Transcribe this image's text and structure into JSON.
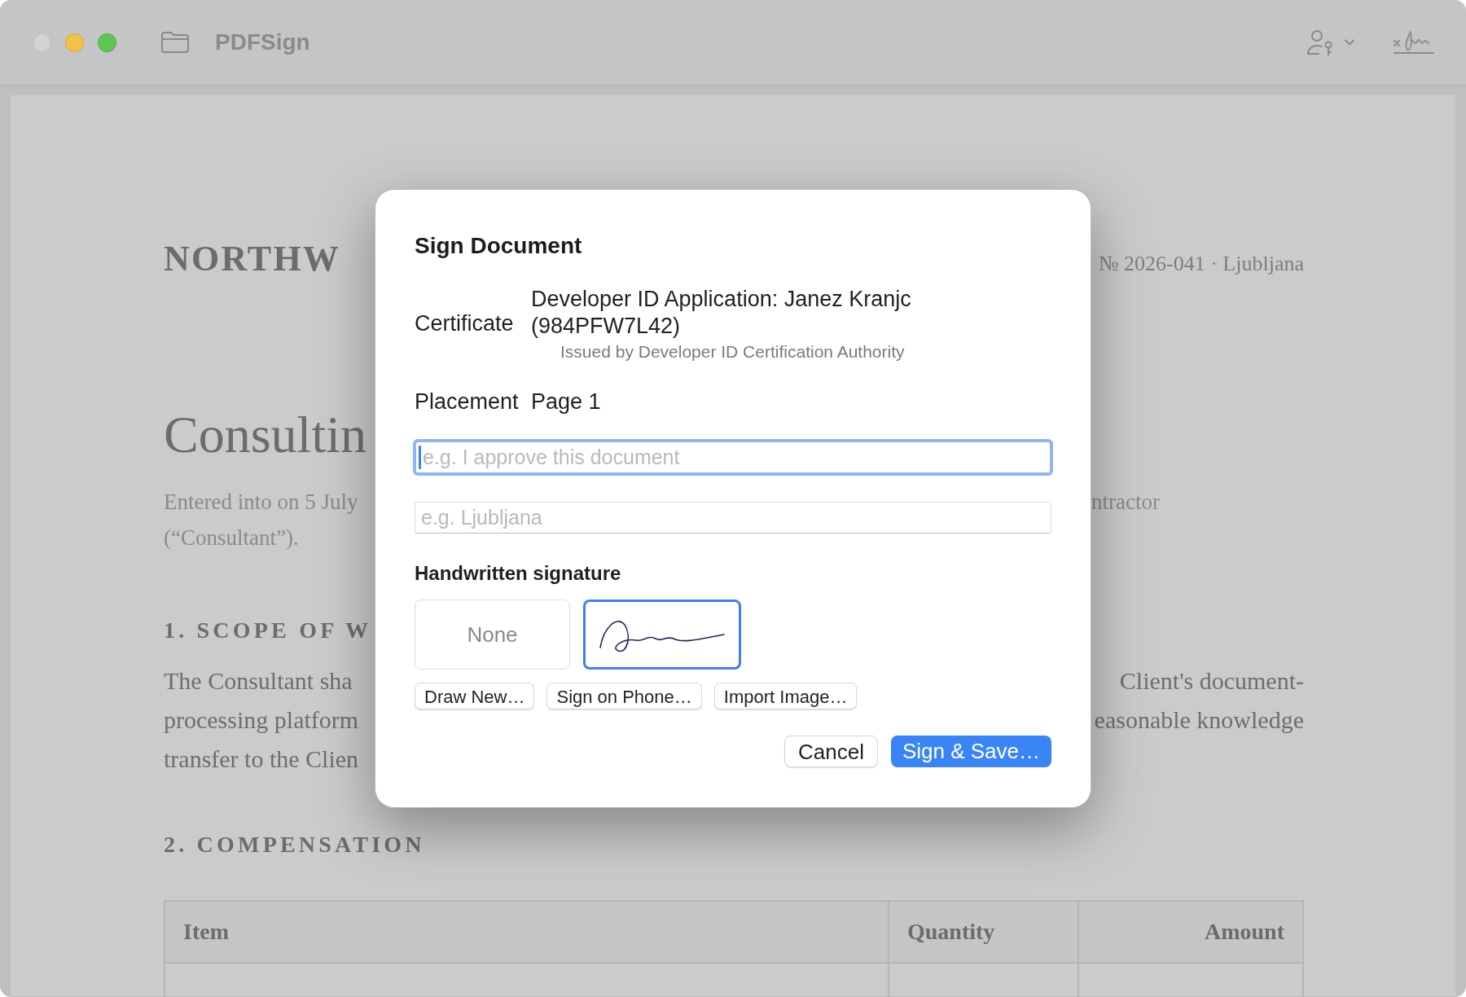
{
  "window": {
    "title": "PDFSign",
    "controls": [
      {
        "kind": "close",
        "disabled": true
      },
      {
        "kind": "minimize",
        "disabled": false
      },
      {
        "kind": "zoom",
        "disabled": false
      }
    ]
  },
  "document": {
    "company": "NORTHW",
    "reference": "№ 2026-041 · Ljubljana",
    "title": "Consultin",
    "intro_lines": [
      {
        "left": "Entered into on 5 July",
        "right": "ntractor"
      },
      {
        "left": "(“Consultant”)."
      }
    ],
    "sections": [
      {
        "heading": "1. SCOPE OF W",
        "lines": [
          {
            "left": "The Consultant sha",
            "right": "Client's document-"
          },
          {
            "left": "processing platform",
            "right": "easonable knowledge"
          },
          {
            "left": "transfer to the Clien"
          }
        ]
      },
      {
        "heading": "2. COMPENSATION"
      }
    ],
    "table": {
      "columns": [
        "Item",
        "Quantity",
        "Amount"
      ]
    }
  },
  "dialog": {
    "title": "Sign Document",
    "certificate": {
      "label": "Certificate",
      "value": "Developer ID Application: Janez Kranjc (984PFW7L42)",
      "issuer": "Issued by Developer ID Certification Authority"
    },
    "placement": {
      "label": "Placement",
      "value": "Page 1"
    },
    "fields": [
      {
        "placeholder": "e.g. I approve this document",
        "focused": true
      },
      {
        "placeholder": "e.g. Ljubljana",
        "focused": false
      }
    ],
    "signature": {
      "heading": "Handwritten signature",
      "options": [
        {
          "kind": "none",
          "label": "None",
          "selected": false
        },
        {
          "kind": "drawing",
          "selected": true
        }
      ],
      "actions": [
        "Draw New…",
        "Sign on Phone…",
        "Import Image…"
      ]
    },
    "buttons": [
      {
        "label": "Cancel",
        "primary": false
      },
      {
        "label": "Sign & Save…",
        "primary": true
      }
    ]
  }
}
